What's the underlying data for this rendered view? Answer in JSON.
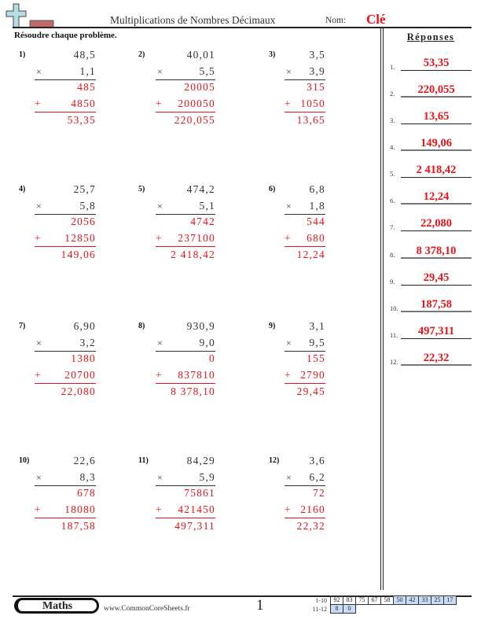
{
  "header": {
    "logo_icon": "plus-and-bar-logo",
    "title": "Multiplications de Nombres Décimaux",
    "name_label": "Nom:",
    "name_value": "Clé",
    "instructions": "Résoudre chaque problème."
  },
  "answers": {
    "title": "Réponses",
    "items": [
      {
        "num": "1.",
        "value": "53,35"
      },
      {
        "num": "2.",
        "value": "220,055"
      },
      {
        "num": "3.",
        "value": "13,65"
      },
      {
        "num": "4.",
        "value": "149,06"
      },
      {
        "num": "5.",
        "value": "2 418,42"
      },
      {
        "num": "6.",
        "value": "12,24"
      },
      {
        "num": "7.",
        "value": "22,080"
      },
      {
        "num": "8.",
        "value": "8 378,10"
      },
      {
        "num": "9.",
        "value": "29,45"
      },
      {
        "num": "10.",
        "value": "187,58"
      },
      {
        "num": "11.",
        "value": "497,311"
      },
      {
        "num": "12.",
        "value": "22,32"
      }
    ]
  },
  "problems": [
    {
      "num": "1)",
      "a": "48,5",
      "times": "×",
      "b": "1,1",
      "p1": "485",
      "plus": "+",
      "p2": "4850",
      "result": "53,35"
    },
    {
      "num": "2)",
      "a": "40,01",
      "times": "×",
      "b": "5,5",
      "p1": "20005",
      "plus": "+",
      "p2": "200050",
      "result": "220,055"
    },
    {
      "num": "3)",
      "a": "3,5",
      "times": "×",
      "b": "3,9",
      "p1": "315",
      "plus": "+",
      "p2": "1050",
      "result": "13,65"
    },
    {
      "num": "4)",
      "a": "25,7",
      "times": "×",
      "b": "5,8",
      "p1": "2056",
      "plus": "+",
      "p2": "12850",
      "result": "149,06"
    },
    {
      "num": "5)",
      "a": "474,2",
      "times": "×",
      "b": "5,1",
      "p1": "4742",
      "plus": "+",
      "p2": "237100",
      "result": "2 418,42"
    },
    {
      "num": "6)",
      "a": "6,8",
      "times": "×",
      "b": "1,8",
      "p1": "544",
      "plus": "+",
      "p2": "680",
      "result": "12,24"
    },
    {
      "num": "7)",
      "a": "6,90",
      "times": "×",
      "b": "3,2",
      "p1": "1380",
      "plus": "+",
      "p2": "20700",
      "result": "22,080"
    },
    {
      "num": "8)",
      "a": "930,9",
      "times": "×",
      "b": "9,0",
      "p1": "0",
      "plus": "+",
      "p2": "837810",
      "result": "8 378,10"
    },
    {
      "num": "9)",
      "a": "3,1",
      "times": "×",
      "b": "9,5",
      "p1": "155",
      "plus": "+",
      "p2": "2790",
      "result": "29,45"
    },
    {
      "num": "10)",
      "a": "22,6",
      "times": "×",
      "b": "8,3",
      "p1": "678",
      "plus": "+",
      "p2": "18080",
      "result": "187,58"
    },
    {
      "num": "11)",
      "a": "84,29",
      "times": "×",
      "b": "5,9",
      "p1": "75861",
      "plus": "+",
      "p2": "421450",
      "result": "497,311"
    },
    {
      "num": "12)",
      "a": "3,6",
      "times": "×",
      "b": "6,2",
      "p1": "72",
      "plus": "+",
      "p2": "2160",
      "result": "22,32"
    }
  ],
  "footer": {
    "badge": "Maths",
    "site": "www.CommonCoreSheets.fr",
    "page": "1",
    "score_rows": [
      {
        "label": "1-10",
        "cells": [
          "92",
          "83",
          "75",
          "67",
          "58",
          "50",
          "42",
          "33",
          "25",
          "17"
        ],
        "highlight_from": 5
      },
      {
        "label": "11-12",
        "cells": [
          "8",
          "0"
        ],
        "highlight_from": 0
      }
    ]
  },
  "colors": {
    "answer_red": "#e8141b",
    "score_highlight": "#c9dcf6"
  }
}
